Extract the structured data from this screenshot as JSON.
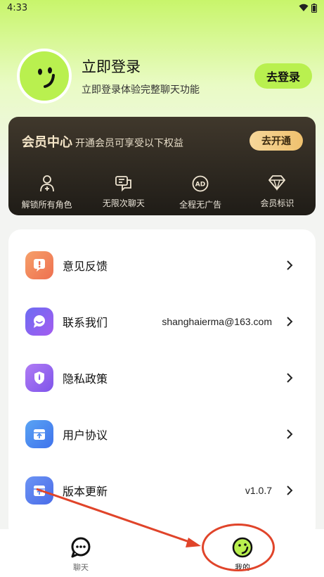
{
  "status": {
    "time": "4:33"
  },
  "profile": {
    "title": "立即登录",
    "subtitle": "立即登录体验完整聊天功能",
    "login_button": "去登录"
  },
  "vip": {
    "title": "会员中心",
    "description": "开通会员可享受以下权益",
    "button": "去开通",
    "benefits": [
      {
        "label": "解锁所有角色",
        "icon": "user-add-icon"
      },
      {
        "label": "无限次聊天",
        "icon": "chat-bubbles-icon"
      },
      {
        "label": "全程无广告",
        "icon": "ad-icon"
      },
      {
        "label": "会员标识",
        "icon": "diamond-icon"
      }
    ]
  },
  "menu": {
    "items": [
      {
        "label": "意见反馈",
        "value": "",
        "icon": "feedback-icon",
        "color": "#f08a5a"
      },
      {
        "label": "联系我们",
        "value": "shanghaierma@163.com",
        "icon": "message-smile-icon",
        "color": "#8a63f0"
      },
      {
        "label": "隐私政策",
        "value": "",
        "icon": "shield-icon",
        "color": "#9b6cf0"
      },
      {
        "label": "用户协议",
        "value": "",
        "icon": "box-icon",
        "color": "#4f8ef0"
      },
      {
        "label": "版本更新",
        "value": "v1.0.7",
        "icon": "update-icon",
        "color": "#5a86f0"
      }
    ]
  },
  "tabbar": {
    "tabs": [
      {
        "label": "聊天",
        "icon": "chat-icon",
        "active": false
      },
      {
        "label": "我的",
        "icon": "face-icon",
        "active": true
      }
    ]
  },
  "colors": {
    "accent": "#b9f04f",
    "annotation": "#e0442a"
  }
}
